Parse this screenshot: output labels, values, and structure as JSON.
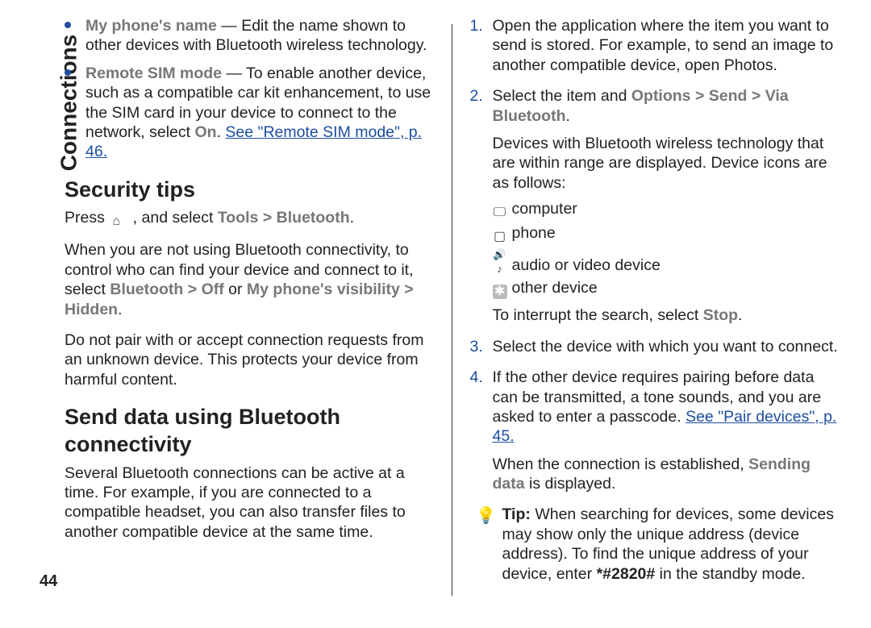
{
  "margin_title": "Connections",
  "page_number": "44",
  "left": {
    "bullets": [
      {
        "name": "My phone's name",
        "sep": " — ",
        "text": "Edit the name shown to other devices with Bluetooth wireless technology."
      },
      {
        "name": "Remote SIM mode",
        "sep": " — ",
        "text": "To enable another device, such as a compatible car kit enhancement, to use the SIM card in your device to connect to the network, select ",
        "on": "On",
        "period": ". ",
        "link": "See \"Remote SIM mode\", p. 46."
      }
    ],
    "h_security": "Security tips",
    "security_press_prefix": "Press ",
    "security_press_mid": " , and select ",
    "security_tools": "Tools",
    "gt": " > ",
    "security_bt": "Bluetooth",
    "security_period": ".",
    "security_p2_a": "When you are not using Bluetooth connectivity, to control who can find your device and connect to it, select ",
    "sec_bluetooth": "Bluetooth",
    "sec_off": "Off",
    "sec_or": " or ",
    "sec_vis": "My phone's visibility",
    "sec_hidden": "Hidden",
    "security_p3": "Do not pair with or accept connection requests from an unknown device. This protects your device from harmful content.",
    "h_send": "Send data using Bluetooth connectivity",
    "send_p1": "Several Bluetooth connections can be active at a time. For example, if you are connected to a compatible headset, you can also transfer files to another compatible device at the same time."
  },
  "right": {
    "steps": {
      "s1": {
        "n": "1.",
        "text": "Open the application where the item you want to send is stored. For example, to send an image to another compatible device, open Photos."
      },
      "s2": {
        "n": "2.",
        "lead": "Select the item and ",
        "options": "Options",
        "send": "Send",
        "via": "Via Bluetooth",
        "period": ".",
        "p2": "Devices with Bluetooth wireless technology that are within range are displayed. Device icons are as follows:",
        "icons": {
          "computer": "computer",
          "phone": "phone",
          "av": "audio or video device",
          "other": "other device"
        },
        "p3_a": "To interrupt the search, select ",
        "p3_stop": "Stop",
        "p3_b": "."
      },
      "s3": {
        "n": "3.",
        "text": "Select the device with which you want to connect."
      },
      "s4": {
        "n": "4.",
        "p1_a": "If the other device requires pairing before data can be transmitted, a tone sounds, and you are asked to enter a passcode. ",
        "link": "See \"Pair devices\", p. 45.",
        "p2_a": "When the connection is established, ",
        "p2_sending": "Sending data",
        "p2_b": " is displayed."
      }
    },
    "tip": {
      "label": "Tip: ",
      "text_a": "When searching for devices, some devices may show only the unique address (device address). To find the unique address of your device, enter ",
      "code": "*#2820#",
      "text_b": " in the standby mode."
    }
  }
}
